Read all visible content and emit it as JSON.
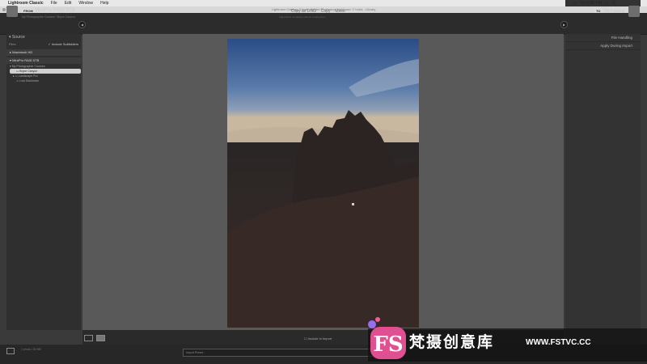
{
  "menubar": {
    "app": "Lightroom Classic",
    "items": [
      "File",
      "Edit",
      "Window",
      "Help"
    ],
    "time": "Fri 1:08 PM"
  },
  "titlebar": {
    "text": "Lightroom Catalog-3.lrcat - Adobe Photoshop Lightroom Classic - Library"
  },
  "source": {
    "tag": "FROM",
    "name": "MiraPro RAID 5TB",
    "path": "My Photographer Courses / Bryce Canyon"
  },
  "modes": {
    "items": [
      "Copy as DNG",
      "Copy",
      "Move",
      "Add"
    ],
    "active": "Add",
    "sub": "Add photos to catalog without moving them"
  },
  "dest": {
    "tag": "TO",
    "name": "My Catalog"
  },
  "left_panel": {
    "header": "Source",
    "files_label": "Files",
    "include_sub": "Include Subfolders",
    "volumes": [
      "Macintosh HD",
      "MiraPro RAID 5TB"
    ],
    "tree": [
      "My Photographer Courses",
      "Bryce Canyon",
      "Landscape Pro",
      "Lost Dutchman"
    ]
  },
  "toolstrip": {
    "include_label": "Include in Import"
  },
  "right_panel": {
    "items": [
      "File Handling",
      "Apply During Import"
    ]
  },
  "bottom": {
    "count": "1 photo / 20 MB",
    "preset": "Import Preset :"
  },
  "watermark": {
    "logo": "FS",
    "text": "梵摄创意库",
    "url": "WWW.FSTVC.CC"
  },
  "colors": {
    "panel": "#2f2f2f",
    "center": "#595959",
    "accent": "#e05090"
  }
}
